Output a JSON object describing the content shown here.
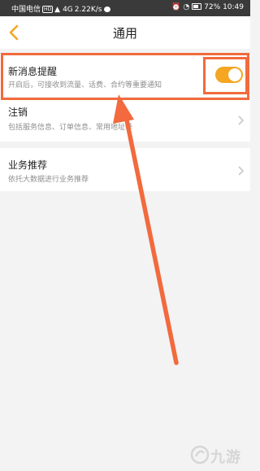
{
  "status_bar": {
    "carrier": "中国电信",
    "hd_badge": "HD",
    "signal": "4G",
    "speed": "2.22K/s",
    "battery": "72%",
    "time": "10:49"
  },
  "nav": {
    "title": "通用"
  },
  "settings": {
    "notifications": {
      "title": "新消息提醒",
      "subtitle": "开启后，可接收到流量、话费、合约等重要通知",
      "enabled": true
    },
    "logout": {
      "title": "注销",
      "subtitle": "包括服务信息、订单信息、常用地址等"
    },
    "recommendation": {
      "title": "业务推荐",
      "subtitle": "依托大数据进行业务推荐"
    }
  },
  "colors": {
    "accent": "#f5a623",
    "annotation": "#f26a3d"
  },
  "watermark": {
    "text": "九游"
  }
}
